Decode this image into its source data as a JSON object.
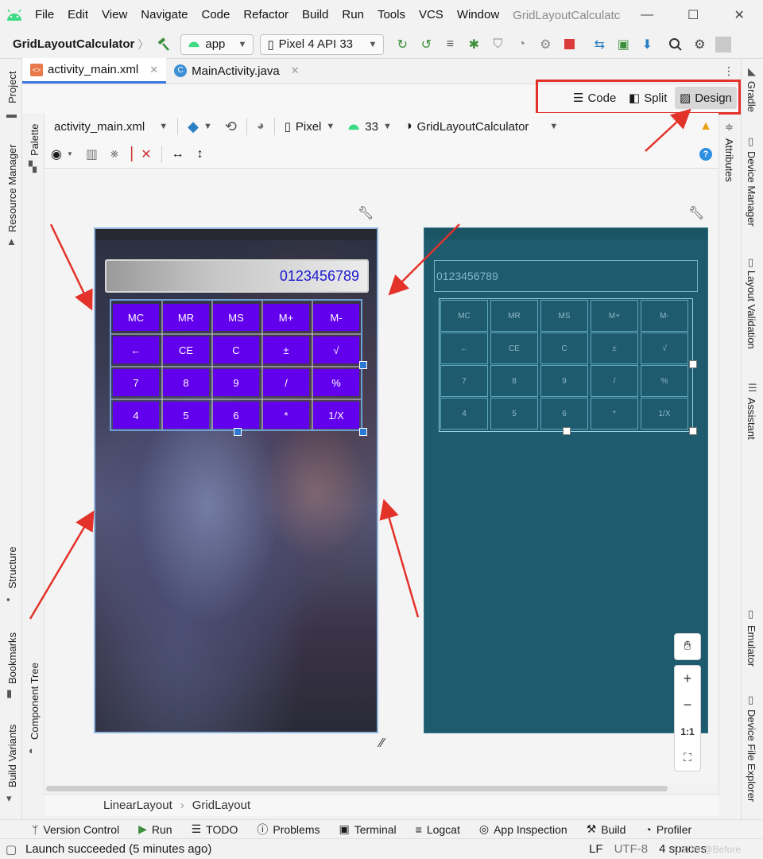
{
  "menu": {
    "items": [
      "File",
      "Edit",
      "View",
      "Navigate",
      "Code",
      "Refactor",
      "Build",
      "Run",
      "Tools",
      "VCS",
      "Window"
    ],
    "window_title": "GridLayoutCalculatc"
  },
  "toolbar": {
    "project_name": "GridLayoutCalculator",
    "run_config": "app",
    "device": "Pixel 4 API 33"
  },
  "tabs": [
    {
      "label": "activity_main.xml",
      "active": true
    },
    {
      "label": "MainActivity.java",
      "active": false
    }
  ],
  "view_modes": {
    "code": "Code",
    "split": "Split",
    "design": "Design",
    "selected": "Design"
  },
  "design_toolbar": {
    "file": "activity_main.xml",
    "device": "Pixel",
    "api": "33",
    "theme": "GridLayoutCalculator"
  },
  "left_strip": {
    "project": "Project",
    "resource_manager": "Resource Manager",
    "structure": "Structure",
    "bookmarks": "Bookmarks",
    "build_variants": "Build Variants",
    "palette": "Palette",
    "component_tree": "Component Tree"
  },
  "right_strip": {
    "gradle": "Gradle",
    "device_manager": "Device Manager",
    "layout_validation": "Layout Validation",
    "assistant": "Assistant",
    "emulator": "Emulator",
    "device_file_explorer": "Device File Explorer",
    "attributes": "Attributes"
  },
  "calculator": {
    "display_value": "0123456789",
    "rows": [
      [
        "MC",
        "MR",
        "MS",
        "M+",
        "M-"
      ],
      [
        "←",
        "CE",
        "C",
        "±",
        "√"
      ],
      [
        "7",
        "8",
        "9",
        "/",
        "%"
      ],
      [
        "4",
        "5",
        "6",
        "*",
        "1/X"
      ]
    ]
  },
  "zoom": {
    "zoom_in": "+",
    "zoom_out": "−",
    "actual_size": "1:1"
  },
  "breadcrumb": [
    "LinearLayout",
    "GridLayout"
  ],
  "bottom_tools": [
    "Version Control",
    "Run",
    "TODO",
    "Problems",
    "Terminal",
    "Logcat",
    "App Inspection",
    "Build",
    "Profiler"
  ],
  "status": {
    "message": "Launch succeeded (5 minutes ago)",
    "line_ending": "LF",
    "encoding": "UTF-8",
    "indent": "4 spaces",
    "watermark": "CSDN @Before"
  },
  "colors": {
    "button_purple": "#6200ee",
    "blueprint_bg": "#1e5b6e",
    "annotation_red": "#e3322a",
    "selection_blue": "#2a79d4",
    "display_text": "#1a1ad0"
  }
}
